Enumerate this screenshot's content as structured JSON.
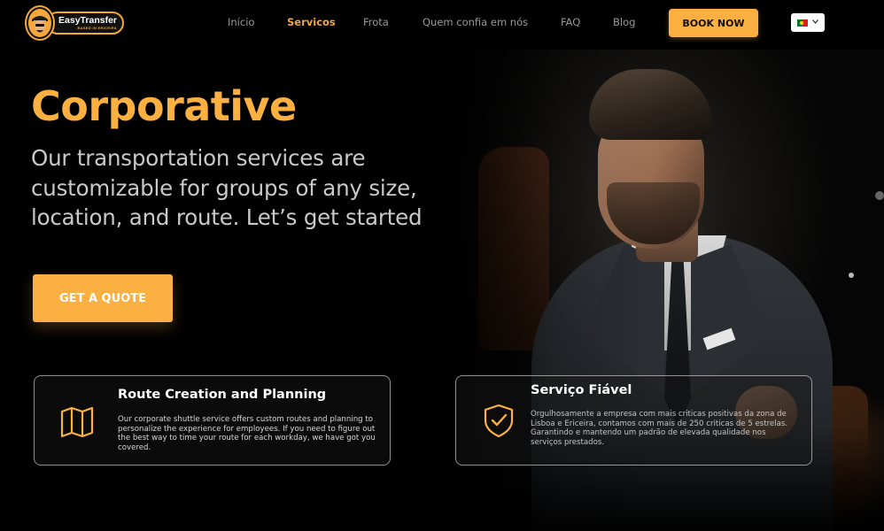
{
  "brand": {
    "name": "EasyTransfer",
    "tagline": "BASED IN ERICEIRA"
  },
  "nav": {
    "items": [
      {
        "label": "Início",
        "active": false
      },
      {
        "label": "Servicos",
        "active": true
      },
      {
        "label": "Frota",
        "active": false
      },
      {
        "label": "Quem confia em nós",
        "active": false
      },
      {
        "label": "FAQ",
        "active": false
      },
      {
        "label": "Blog",
        "active": false
      }
    ],
    "book_label": "BOOK NOW",
    "language": {
      "flag_icon": "portugal-flag-icon",
      "dropdown_icon": "chevron-down-icon"
    }
  },
  "hero": {
    "title": "Corporative",
    "subtitle": "Our transportation services are customizable for groups of any size, location, and route. Let’s get started",
    "cta_label": "GET A QUOTE"
  },
  "cards": [
    {
      "icon": "map-icon",
      "title": "Route Creation and Planning",
      "text": "Our corporate shuttle service offers custom routes and planning to personalize the experience for employees. If you need to figure out the best way to time your route for each workday, we have got you covered."
    },
    {
      "icon": "shield-check-icon",
      "title": "Serviço Fiável",
      "text": "Orgulhosamente a empresa com mais criticas positivas da zona de Lisboa e Ericeira, contamos com mais de 250 criticas de 5 estrelas. Garantindo e mantendo um padrão de elevada qualidade nos serviços prestados."
    }
  ],
  "colors": {
    "accent": "#fbb041",
    "background": "#000000",
    "nav_text": "#9a9a9a"
  }
}
